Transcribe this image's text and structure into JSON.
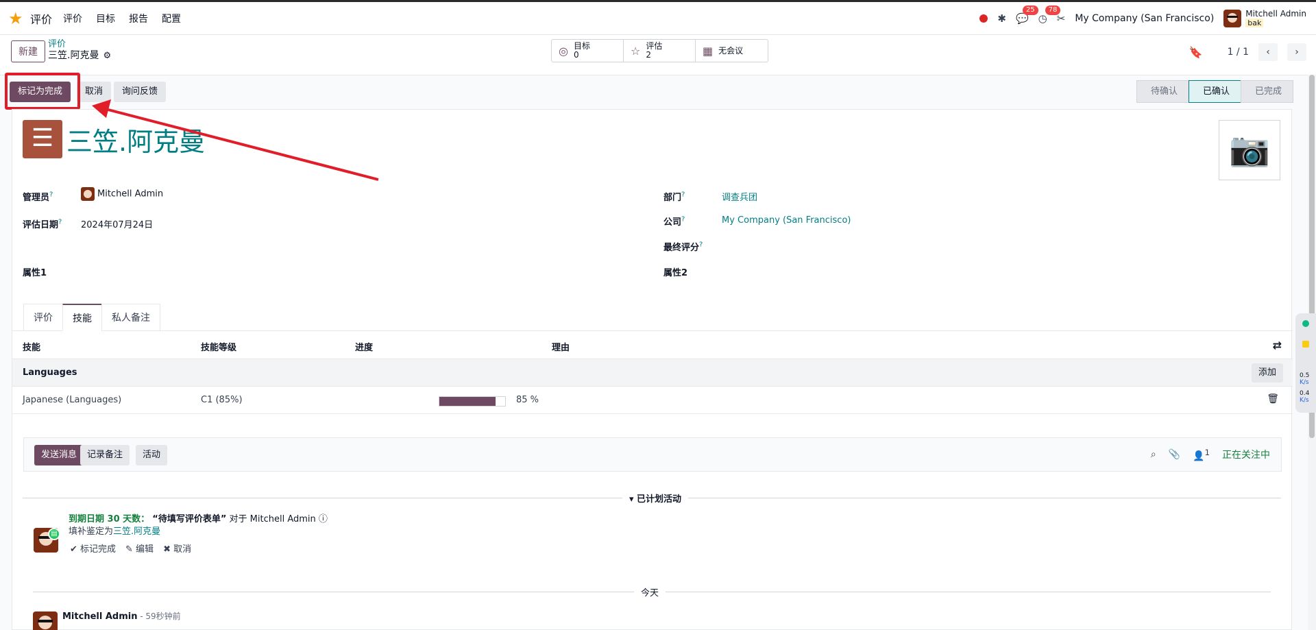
{
  "navbar": {
    "app_name": "评价",
    "menu": [
      "评价",
      "目标",
      "报告",
      "配置"
    ],
    "chat_badge": "25",
    "activity_badge": "78",
    "company": "My Company (San Francisco)",
    "user_name": "Mitchell Admin",
    "db_name": "bak"
  },
  "control": {
    "new_label": "新建",
    "breadcrumb_parent": "评价",
    "breadcrumb_current": "三笠.阿克曼",
    "smart_buttons": [
      {
        "label": "目标",
        "value": "0",
        "icon": "target-icon"
      },
      {
        "label": "评估",
        "value": "2",
        "icon": "star-icon"
      },
      {
        "label": "无会议",
        "value": "",
        "icon": "calendar-icon"
      }
    ],
    "pager": "1 / 1"
  },
  "statusbar": {
    "mark_done": "标记为完成",
    "cancel": "取消",
    "ask_feedback": "询问反馈",
    "stages": [
      "待确认",
      "已确认",
      "已完成"
    ],
    "active_stage": "已确认"
  },
  "record": {
    "title": "三笠.阿克曼",
    "manager_label": "管理员",
    "manager_value": "Mitchell Admin",
    "date_label": "评估日期",
    "date_value": "2024年07月24日",
    "prop1_label": "属性1",
    "department_label": "部门",
    "department_value": "调查兵团",
    "company_label": "公司",
    "company_value": "My Company (San Francisco)",
    "final_score_label": "最终评分",
    "prop2_label": "属性2",
    "help_mark": "?"
  },
  "tabs": [
    "评价",
    "技能",
    "私人备注"
  ],
  "skills": {
    "headers": [
      "技能",
      "技能等级",
      "进度",
      "理由"
    ],
    "group": "Languages",
    "add_label": "添加",
    "rows": [
      {
        "skill": "Japanese (Languages)",
        "level": "C1 (85%)",
        "progress": 85,
        "progress_text": "85 %"
      }
    ]
  },
  "chatter": {
    "send_message": "发送消息",
    "log_note": "记录备注",
    "activity": "活动",
    "follower_count": "1",
    "following": "正在关注中",
    "planned_label": "▾ 已计划活动",
    "activity_due": "到期日期 30 天数：",
    "activity_title": "“待填写评价表单”",
    "activity_for": "对于 Mitchell Admin",
    "activity_desc_prefix": "填补鉴定为",
    "activity_desc_link": "三笠.阿克曼",
    "act_mark_done": "✔ 标记完成",
    "act_edit": "✎ 编辑",
    "act_cancel": "✖ 取消",
    "today_label": "今天",
    "msg_author": "Mitchell Admin",
    "msg_time": " - 59秒钟前"
  },
  "side_widget": {
    "up": "0.5",
    "down": "0.4",
    "unit": "K/s"
  },
  "colors": {
    "primary": "#6d4a61",
    "link": "#017e84",
    "annotation": "#e11d2a"
  }
}
